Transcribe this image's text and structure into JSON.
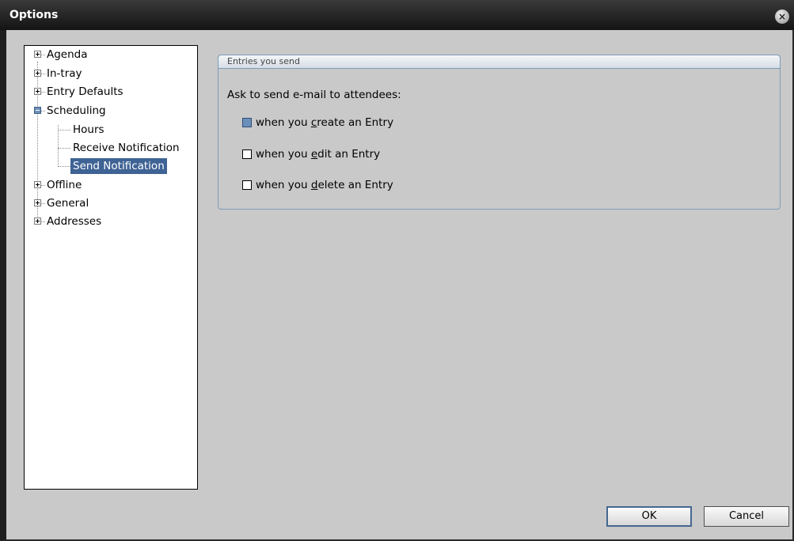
{
  "window": {
    "title": "Options",
    "close_glyph": "×"
  },
  "tree": {
    "items": [
      {
        "label": "Agenda",
        "expander": "plus",
        "level": 0
      },
      {
        "label": "In-tray",
        "expander": "plus",
        "level": 0
      },
      {
        "label": "Entry Defaults",
        "expander": "plus",
        "level": 0
      },
      {
        "label": "Scheduling",
        "expander": "minus",
        "level": 0
      },
      {
        "label": "Hours",
        "expander": "none",
        "level": 1
      },
      {
        "label": "Receive Notification",
        "expander": "none",
        "level": 1
      },
      {
        "label": "Send Notification",
        "expander": "none",
        "level": 1,
        "selected": true
      },
      {
        "label": "Offline",
        "expander": "plus",
        "level": 0
      },
      {
        "label": "General",
        "expander": "plus",
        "level": 0
      },
      {
        "label": "Addresses",
        "expander": "plus",
        "level": 0
      }
    ]
  },
  "group": {
    "title": "Entries you send",
    "prompt": "Ask to send e-mail to attendees:",
    "options": [
      {
        "label_pre": "when you ",
        "mnemonic": "c",
        "label_post": "reate an Entry",
        "checked": true
      },
      {
        "label_pre": "when you ",
        "mnemonic": "e",
        "label_post": "dit an Entry",
        "checked": false
      },
      {
        "label_pre": "when you ",
        "mnemonic": "d",
        "label_post": "elete an Entry",
        "checked": false
      }
    ]
  },
  "buttons": {
    "ok": "OK",
    "cancel": "Cancel"
  },
  "colors": {
    "selection": "#3f6394",
    "checkbox_checked": "#6b8fb9",
    "groupbox_border": "#7f9bb8",
    "window_bg": "#c9c9c9"
  }
}
